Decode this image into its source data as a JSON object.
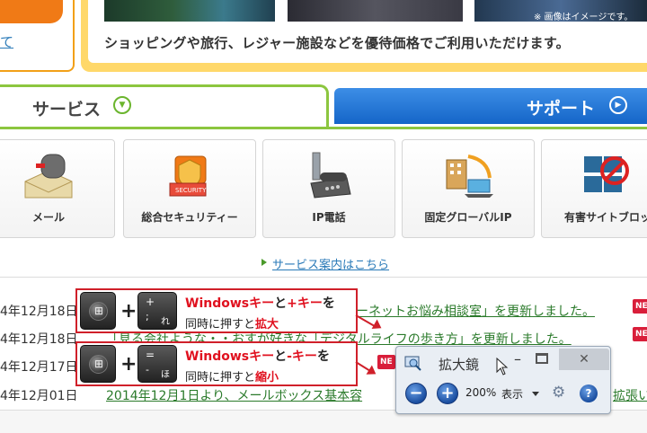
{
  "top_left": {
    "link_text": "て"
  },
  "promo": {
    "image_note": "※ 画像はイメージです。",
    "text": "ショッピングや旅行、レジャー施設などを優待価格でご利用いただけます。"
  },
  "tabs": {
    "service": {
      "label": "サービス",
      "icon": "circle-chevron-down-icon"
    },
    "support": {
      "label": "サポート",
      "icon": "circle-chevron-right-icon"
    }
  },
  "services": [
    {
      "label": "メール",
      "icon": "mailbox-icon"
    },
    {
      "label": "総合セキュリティー",
      "icon": "security-icon"
    },
    {
      "label": "IP電話",
      "icon": "ip-phone-icon"
    },
    {
      "label": "固定グローバルIP",
      "icon": "global-ip-icon"
    },
    {
      "label": "有害サイトブロッ",
      "icon": "block-site-icon"
    }
  ],
  "service_link": "サービス案内はこちら",
  "news": [
    {
      "date": "4年12月18日",
      "text": "ーネットお悩み相談室」を更新しました。",
      "badge": "NE"
    },
    {
      "date": "4年12月18日",
      "text": "「見る会社ような・・おすが好きな「デジタルライフの歩き方」を更新しました。",
      "badge": "NE"
    },
    {
      "date": "4年12月17日",
      "text": "",
      "badge": "NE"
    },
    {
      "date": "4年12月01日",
      "text": "2014年12月1日より、メールボックス基本容",
      "suffix": "拡張い"
    }
  ],
  "callouts": [
    {
      "key_top": "+",
      "key_mid": ";",
      "key_kana": "れ",
      "line1_a": "Windowsキー",
      "line1_b": "と",
      "line1_c": "+キー",
      "line1_d": "を",
      "line2_a": "同時に押すと",
      "line2_b": "拡大"
    },
    {
      "key_top": "=",
      "key_mid": "-",
      "key_kana": "ほ",
      "line1_a": "Windowsキー",
      "line1_b": "と",
      "line1_c": "-キー",
      "line1_d": "を",
      "line2_a": "同時に押すと",
      "line2_b": "縮小"
    }
  ],
  "plus_sign": "+",
  "magnifier": {
    "title": "拡大鏡",
    "zoom_out": "−",
    "zoom_in": "+",
    "zoom_level": "200%",
    "view_label": "表示",
    "close": "✕",
    "help": "?"
  },
  "colors": {
    "accent_red": "#d0202a",
    "tab_green": "#8cc63f",
    "support_blue": "#1565c8"
  }
}
